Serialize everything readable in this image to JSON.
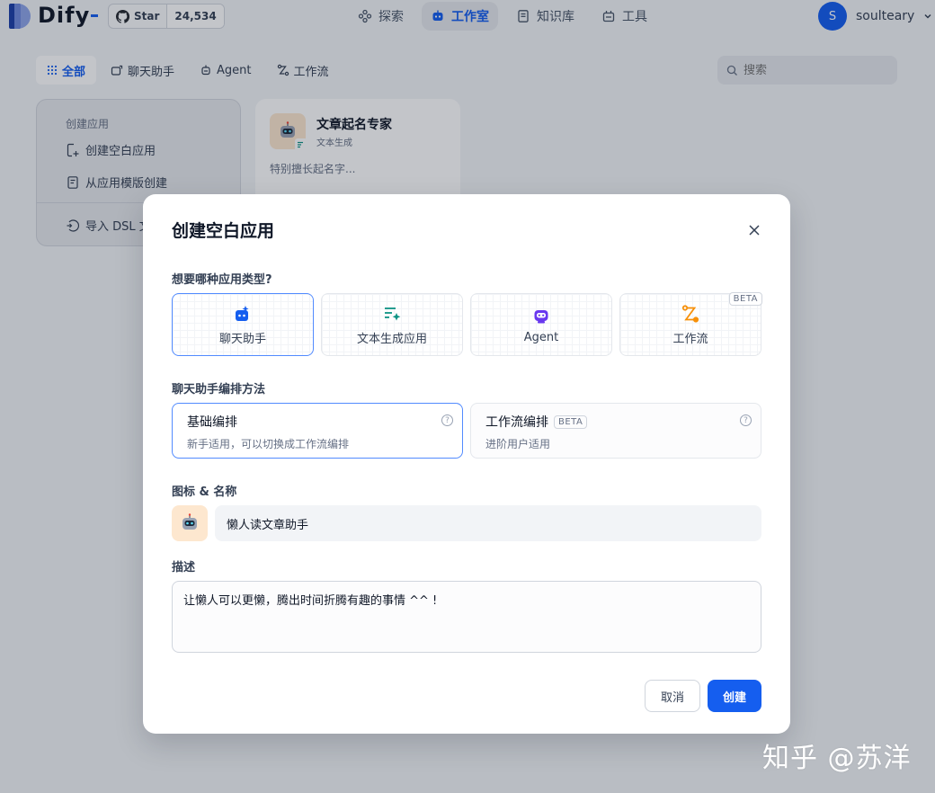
{
  "brand": {
    "name": "Dify"
  },
  "github": {
    "label": "Star",
    "count": "24,534"
  },
  "nav": {
    "tabs": [
      {
        "label": "探索"
      },
      {
        "label": "工作室"
      },
      {
        "label": "知识库"
      },
      {
        "label": "工具"
      }
    ],
    "active_tab": "工作室"
  },
  "user": {
    "initial": "S",
    "name": "soulteary"
  },
  "filters": {
    "items": [
      {
        "label": "全部"
      },
      {
        "label": "聊天助手"
      },
      {
        "label": "Agent"
      },
      {
        "label": "工作流"
      }
    ],
    "active": "全部"
  },
  "search": {
    "placeholder": "搜索"
  },
  "create_card": {
    "heading": "创建应用",
    "blank": "创建空白应用",
    "from_template": "从应用模版创建",
    "import_dsl": "导入 DSL 文"
  },
  "app_card": {
    "title": "文章起名专家",
    "subtitle": "文本生成",
    "description": "特别擅长起名字..."
  },
  "modal": {
    "title": "创建空白应用",
    "type_label": "想要哪种应用类型?",
    "types": [
      {
        "label": "聊天助手",
        "selected": true
      },
      {
        "label": "文本生成应用",
        "selected": false
      },
      {
        "label": "Agent",
        "selected": false
      },
      {
        "label": "工作流",
        "selected": false,
        "badge": "BETA"
      }
    ],
    "mode_label": "聊天助手编排方法",
    "modes": [
      {
        "title": "基础编排",
        "desc": "新手适用，可以切换成工作流编排",
        "selected": true
      },
      {
        "title": "工作流编排",
        "badge": "BETA",
        "desc": "进阶用户适用",
        "selected": false
      }
    ],
    "name_label": "图标 & 名称",
    "name_value": "懒人读文章助手",
    "desc_label": "描述",
    "desc_value": "让懒人可以更懒，腾出时间折腾有趣的事情 ^^ !",
    "cancel": "取消",
    "create": "创建"
  },
  "watermark": "知乎 @苏洋",
  "colors": {
    "accent": "#155eef",
    "selected_border": "#528bff",
    "icon_bg": "#fde7cf"
  }
}
